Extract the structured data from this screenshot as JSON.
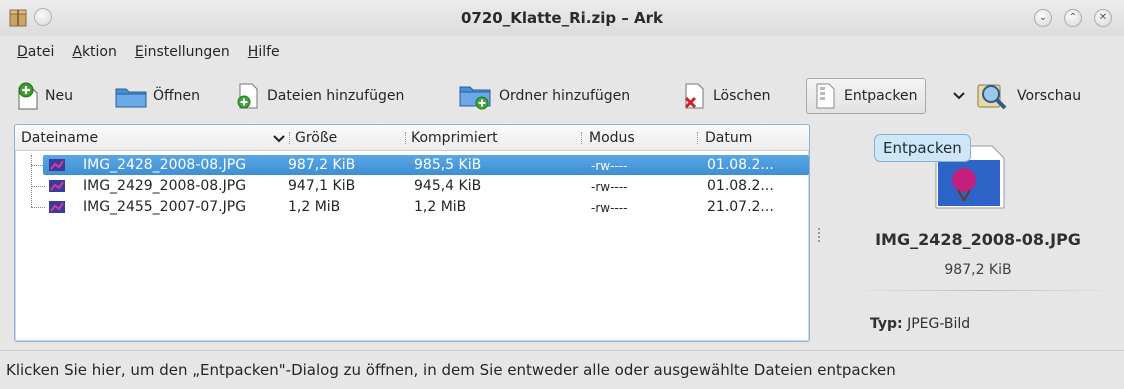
{
  "window": {
    "title": "0720_Klatte_Ri.zip – Ark",
    "buttons": [
      "⌄",
      "⌃",
      "✕"
    ]
  },
  "menubar": [
    {
      "accel": "D",
      "rest": "atei"
    },
    {
      "accel": "A",
      "rest": "ktion"
    },
    {
      "accel": "E",
      "rest": "instellungen"
    },
    {
      "accel": "H",
      "rest": "ilfe"
    }
  ],
  "toolbar": {
    "new_label": "Neu",
    "open_label": "Öffnen",
    "add_files_label": "Dateien hinzufügen",
    "add_folder_label": "Ordner hinzufügen",
    "delete_label": "Löschen",
    "extract_label": "Entpacken",
    "preview_label": "Vorschau"
  },
  "table": {
    "columns": [
      "Dateiname",
      "Größe",
      "Komprimiert",
      "Modus",
      "Datum"
    ],
    "rows": [
      {
        "name": "IMG_2428_2008-08.JPG",
        "size": "987,2 KiB",
        "compressed": "985,5 KiB",
        "mode": "-rw----",
        "date": "01.08.2...",
        "selected": true
      },
      {
        "name": "IMG_2429_2008-08.JPG",
        "size": "947,1 KiB",
        "compressed": "945,4 KiB",
        "mode": "-rw----",
        "date": "01.08.2...",
        "selected": false
      },
      {
        "name": "IMG_2455_2007-07.JPG",
        "size": "1,2 MiB",
        "compressed": "1,2 MiB",
        "mode": "-rw----",
        "date": "21.07.2...",
        "selected": false
      }
    ]
  },
  "preview": {
    "tooltip": "Entpacken",
    "file_name": "IMG_2428_2008-08.JPG",
    "file_size": "987,2 KiB",
    "type_label": "Typ:",
    "type_value": "JPEG-Bild"
  },
  "status": {
    "text": "Klicken Sie hier, um den „Entpacken\"-Dialog zu öffnen, in dem Sie entweder alle oder ausgewählte Dateien entpacken"
  },
  "colors": {
    "selection": "#4a9ad8",
    "frame_border": "#8fb3d6"
  }
}
